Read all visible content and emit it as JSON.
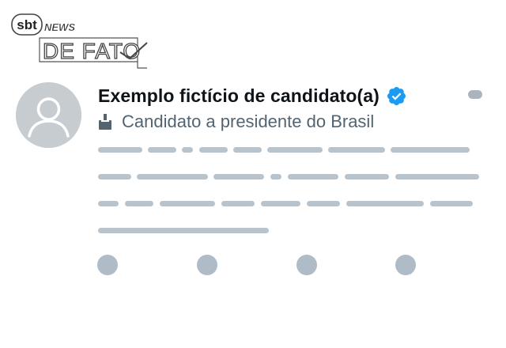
{
  "watermark": {
    "brand": "sbt",
    "news": "NEWS",
    "title": "DE FATO"
  },
  "post": {
    "display_name": "Exemplo fictício de candidato(a)",
    "verified": true,
    "verified_color": "#1d9bf0",
    "label_icon": "ballot-box-icon",
    "label_text": "Candidato a presidente do Brasil",
    "placeholder_color": "#b9c3cc"
  },
  "actions": [
    {
      "name": "reply-icon"
    },
    {
      "name": "repost-icon"
    },
    {
      "name": "like-icon"
    },
    {
      "name": "share-icon"
    }
  ]
}
